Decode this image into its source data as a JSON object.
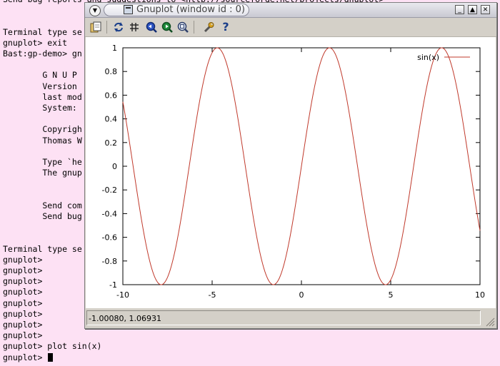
{
  "terminal": {
    "lines": [
      "Send bug reports and suggestions to <http://sourceforge.net/projects/gnuplot>",
      "",
      "",
      "Terminal type se",
      "gnuplot> exit",
      "Bast:gp-demo> gn",
      "",
      "        G N U P",
      "        Version",
      "        last mod",
      "        System:",
      "",
      "        Copyrigh",
      "        Thomas W",
      "",
      "        Type `he",
      "        The gnup",
      "",
      "",
      "        Send com",
      "        Send bug",
      "",
      "",
      "Terminal type se",
      "gnuplot>",
      "gnuplot>",
      "gnuplot>",
      "gnuplot>",
      "gnuplot>",
      "gnuplot>",
      "gnuplot>",
      "gnuplot>",
      "gnuplot> plot sin(x)"
    ],
    "prompt": "gnuplot> "
  },
  "window": {
    "title": "Gnuplot (window id : 0)",
    "buttons": {
      "minimize": "minimize-icon",
      "maximize": "maximize-icon",
      "close": "close-icon"
    }
  },
  "toolbar": {
    "icons": [
      "copy-clipboard-icon",
      "replot-icon",
      "grid-icon",
      "zoom-prev-icon",
      "zoom-next-icon",
      "autoscale-icon",
      "options-wrench-icon",
      "help-icon"
    ],
    "help_glyph": "?"
  },
  "status": {
    "coordinates": "-1.00080,  1.06931"
  },
  "colors": {
    "curve": "#c0392b",
    "terminal_bg": "#fde1f4"
  },
  "chart_data": {
    "type": "line",
    "series": [
      {
        "name": "sin(x)",
        "function": "sin(x)"
      }
    ],
    "xlim": [
      -10,
      10
    ],
    "ylim": [
      -1,
      1
    ],
    "xticks": [
      "-10",
      "-5",
      "0",
      "5",
      "10"
    ],
    "yticks": [
      "-1",
      "-0.8",
      "-0.6",
      "-0.4",
      "-0.2",
      "0",
      "0.2",
      "0.4",
      "0.6",
      "0.8",
      "1"
    ],
    "legend": "top-right",
    "grid": false
  }
}
